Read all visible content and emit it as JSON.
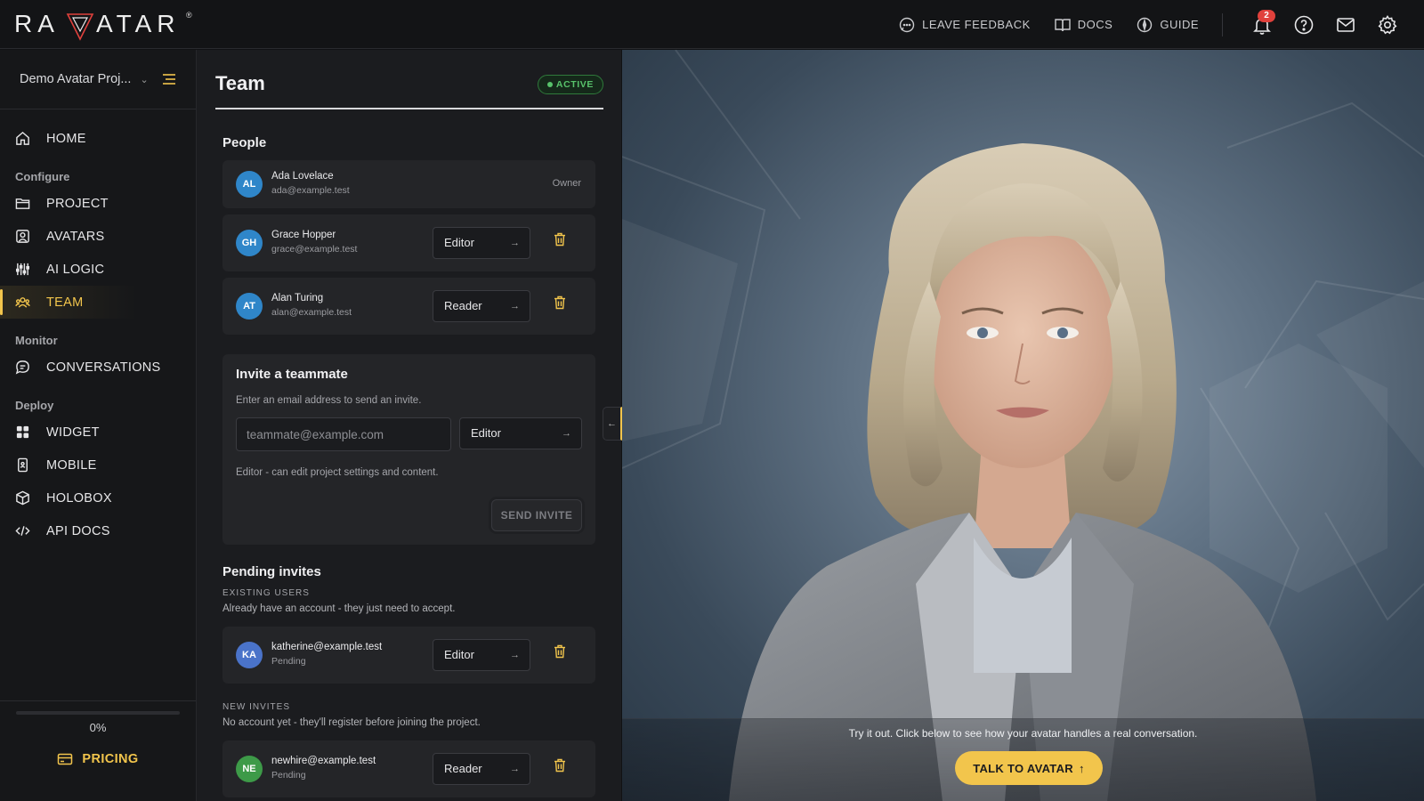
{
  "brand": {
    "logo_text": "RAVATAR",
    "reg": "®"
  },
  "topbar": {
    "links": [
      {
        "label": "LEAVE FEEDBACK",
        "icon": "feedback-icon"
      },
      {
        "label": "DOCS",
        "icon": "book-icon"
      },
      {
        "label": "GUIDE",
        "icon": "guide-icon"
      }
    ],
    "notifications_count": "2"
  },
  "sidebar": {
    "project_name": "Demo Avatar Proj...",
    "items": [
      {
        "label": "HOME"
      },
      {
        "section": "Configure"
      },
      {
        "label": "PROJECT"
      },
      {
        "label": "AVATARS"
      },
      {
        "label": "AI LOGIC"
      },
      {
        "label": "TEAM"
      },
      {
        "section": "Monitor"
      },
      {
        "label": "CONVERSATIONS"
      },
      {
        "section": "Deploy"
      },
      {
        "label": "WIDGET"
      },
      {
        "label": "MOBILE"
      },
      {
        "label": "HOLOBOX"
      },
      {
        "label": "API DOCS"
      }
    ],
    "progress": 0,
    "progress_label": "0%",
    "pricing_label": "PRICING"
  },
  "panel": {
    "title": "Team",
    "status": "ACTIVE",
    "people_title": "People",
    "people": [
      {
        "initials": "AL",
        "name": "Ada Lovelace",
        "email": "ada@example.test",
        "role": "Owner",
        "color": "#2f86c9"
      },
      {
        "initials": "GH",
        "name": "Grace Hopper",
        "email": "grace@example.test",
        "role": "Editor",
        "color": "#2f86c9"
      },
      {
        "initials": "AT",
        "name": "Alan Turing",
        "email": "alan@example.test",
        "role": "Reader",
        "color": "#2f86c9"
      }
    ],
    "invite": {
      "title": "Invite a teammate",
      "subtitle": "Enter an email address to send an invite.",
      "placeholder": "teammate@example.com",
      "role": "Editor",
      "hint": "Editor - can edit project settings and content.",
      "send_label": "SEND INVITE"
    },
    "pending_title": "Pending invites",
    "existing": {
      "caption": "EXISTING USERS",
      "desc": "Already have an account - they just need to accept.",
      "items": [
        {
          "initials": "KA",
          "email": "katherine@example.test",
          "status": "Pending",
          "role": "Editor",
          "color": "#4a73c9"
        }
      ]
    },
    "new_invites": {
      "caption": "NEW INVITES",
      "desc": "No account yet - they'll register before joining the project.",
      "items": [
        {
          "initials": "NE",
          "email": "newhire@example.test",
          "status": "Pending",
          "role": "Reader",
          "color": "#3d9a48"
        }
      ]
    }
  },
  "stage": {
    "try_text": "Try it out. Click below to see how your avatar handles a real conversation.",
    "talk_label": "TALK TO AVATAR"
  },
  "colors": {
    "accent": "#f2c54c",
    "active_green": "#58c26b",
    "badge_red": "#e0413c"
  }
}
